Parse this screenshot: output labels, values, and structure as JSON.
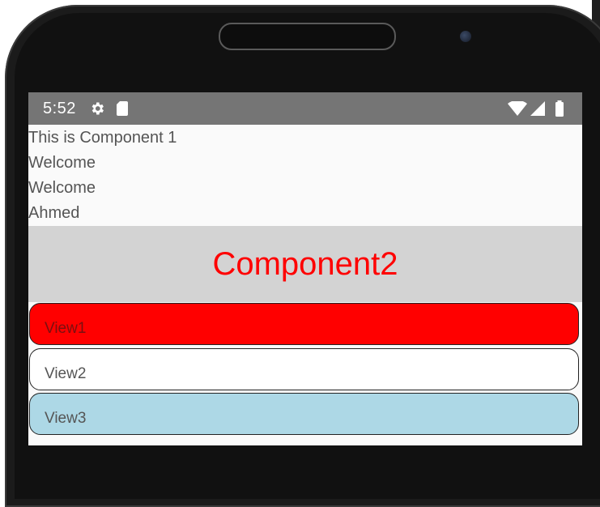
{
  "status_bar": {
    "time": "5:52",
    "icons": [
      "gear-icon",
      "sd-card-icon",
      "wifi-icon",
      "signal-icon",
      "battery-icon"
    ],
    "background": "#757575"
  },
  "component1": {
    "lines": [
      "This is Component 1",
      "Welcome",
      "Welcome",
      "Ahmed"
    ]
  },
  "component2": {
    "title": "Component2",
    "title_color": "#ff0000",
    "background": "#d3d3d3"
  },
  "views": [
    {
      "label": "View1",
      "background": "#ff0000"
    },
    {
      "label": "View2",
      "background": "#ffffff"
    },
    {
      "label": "View3",
      "background": "#add8e6"
    }
  ]
}
